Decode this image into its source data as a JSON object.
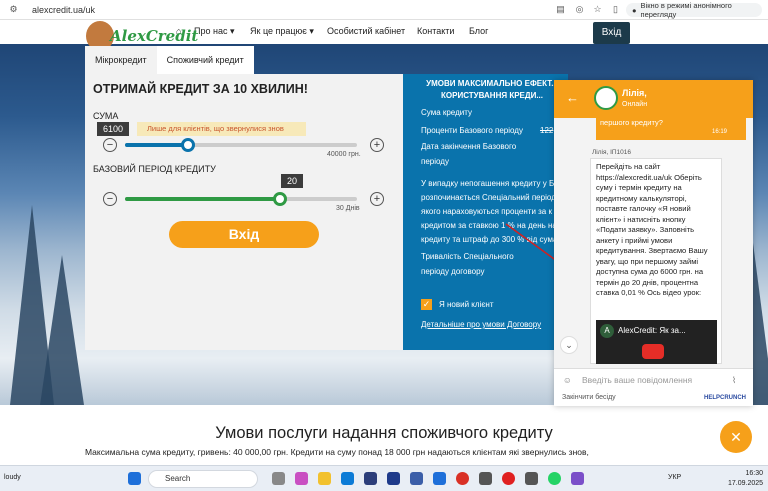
{
  "browser": {
    "url": "alexcredit.ua/uk",
    "incognito_label": "Вікно в режимі анонімного перегляду"
  },
  "logo": {
    "text": "AlexCredit"
  },
  "nav": {
    "items": [
      "Про нас",
      "Як це працює",
      "Особистий кабінет",
      "Контакти",
      "Блог"
    ],
    "login": "Вхід"
  },
  "tabs": [
    "Мікрокредит",
    "Споживчий кредит"
  ],
  "calculator": {
    "title": "ОТРИМАЙ КРЕДИТ ЗА 10 ХВИЛИН!",
    "amount_label": "СУМА",
    "amount_value": "6100",
    "amount_note": "Лише для клієнтів, що звернулися знов",
    "amount_max": "40000 грн.",
    "amount_fraction": 0.27,
    "period_label": "БАЗОВИЙ ПЕРІОД КРЕДИТУ",
    "period_value": "20",
    "period_max": "30 Днів",
    "period_fraction": 0.67,
    "submit": "Вхід",
    "minus": "−",
    "plus": "+"
  },
  "conditions": {
    "title": "УМОВИ МАКСИМАЛЬНО ЕФЕКТ... КОРИСТУВАННЯ КРЕДИ...",
    "lines": [
      "Сума кредиту",
      "Проценти Базового періоду",
      "Дата закінчення Базового",
      "періоду",
      "У випадку непогашення кредиту у Б",
      "розпочинається Спеціальний період",
      "якого нараховуються проценти за к",
      "кредитом за ставкою 1 % на день на",
      "кредиту та штраф до 300 % від сума",
      "Тривалість Спеціального",
      "періоду договору"
    ],
    "rate_struck": "122",
    "new_client": "Я новий клієнт",
    "details_link": "Детальніше про умови Договору"
  },
  "chat": {
    "agent_name": "Лілія,",
    "agent_status": "Онлайн",
    "prev_message": "першого кредиту?",
    "prev_time": "16:19",
    "author": "Лілія, ІП1016",
    "message": "Перейдіть на сайт https://alexcredit.ua/uk Оберіть суму і термін кредиту на кредитному калькуляторі, поставте галочку «Я новий клієнт» і натисніть кнопку «Подати заявку». Заповніть анкету і приймі умови кредитування. Звертаємо Вашу увагу, що при першому займі доступна сума до 6000 грн. на термін до 20 днів, процентна ставка 0,01 % Ось відео урок:",
    "video_title": "AlexCredit: Як за...",
    "input_placeholder": "Введіть ваше повідомлення",
    "end_chat": "Закінчити бесіду",
    "powered": "HELPCRUNCH"
  },
  "section": {
    "title": "Умови послуги надання споживчого кредиту",
    "text": "Максимальна сума кредиту, гривень: 40 000,00 грн. Кредити на суму понад 18 000 грн надаються клієнтам які звернулись знов,"
  },
  "taskbar": {
    "search": "Search",
    "weather": "loudy",
    "lang": "УКР",
    "time": "16:30",
    "date": "17.09.2025"
  },
  "colors": {
    "accent": "#f6a01a",
    "blue_panel": "#0a73ac",
    "green": "#2f9a44",
    "slider_blue": "#0a73ac"
  }
}
